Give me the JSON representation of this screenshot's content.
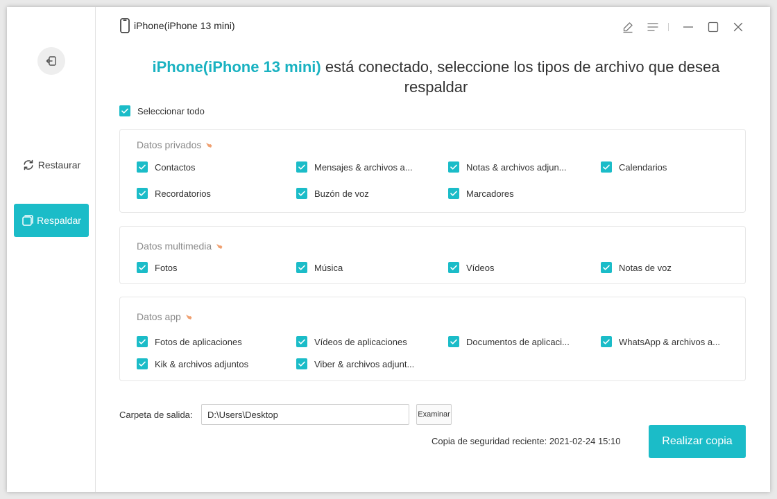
{
  "window": {
    "device_title": "iPhone(iPhone 13 mini)"
  },
  "sidebar": {
    "restore_label": "Restaurar",
    "backup_label": "Respaldar"
  },
  "headline": {
    "device": "iPhone(iPhone 13 mini)",
    "line1_rest": " está conectado, seleccione los tipos de archivo que desea",
    "line2": "respaldar"
  },
  "select_all": {
    "label": "Seleccionar todo",
    "checked": true
  },
  "groups": [
    {
      "title": "Datos privados",
      "items": [
        {
          "label": "Contactos",
          "checked": true
        },
        {
          "label": "Mensajes & archivos a...",
          "checked": true
        },
        {
          "label": "Notas & archivos adjun...",
          "checked": true
        },
        {
          "label": "Calendarios",
          "checked": true
        },
        {
          "label": "Recordatorios",
          "checked": true
        },
        {
          "label": "Buzón de voz",
          "checked": true
        },
        {
          "label": "Marcadores",
          "checked": true
        }
      ]
    },
    {
      "title": "Datos multimedia",
      "items": [
        {
          "label": "Fotos",
          "checked": true
        },
        {
          "label": "Música",
          "checked": true
        },
        {
          "label": "Vídeos",
          "checked": true
        },
        {
          "label": "Notas de voz",
          "checked": true
        }
      ]
    },
    {
      "title": "Datos app",
      "items": [
        {
          "label": "Fotos de aplicaciones",
          "checked": true
        },
        {
          "label": "Vídeos de aplicaciones",
          "checked": true
        },
        {
          "label": "Documentos de aplicaci...",
          "checked": true
        },
        {
          "label": "WhatsApp & archivos a...",
          "checked": true
        },
        {
          "label": "Kik & archivos adjuntos",
          "checked": true
        },
        {
          "label": "Viber & archivos adjunt...",
          "checked": true
        }
      ]
    }
  ],
  "output": {
    "label": "Carpeta de salida:",
    "path": "D:\\Users\\Desktop",
    "browse_label": "Examinar"
  },
  "recent_backup": "Copia de seguridad reciente: 2021-02-24 15:10",
  "backup_button": "Realizar copia",
  "colors": {
    "accent": "#1bbcc8",
    "accent_text": "#1ab2c1",
    "hint_icon": "#f0a070"
  },
  "icons": [
    "back-icon",
    "restore-icon",
    "backup-icon",
    "phone-icon",
    "edit-icon",
    "menu-icon",
    "minimize-icon",
    "maximize-icon",
    "close-icon",
    "checkbox-checked-icon",
    "hint-hand-icon"
  ]
}
